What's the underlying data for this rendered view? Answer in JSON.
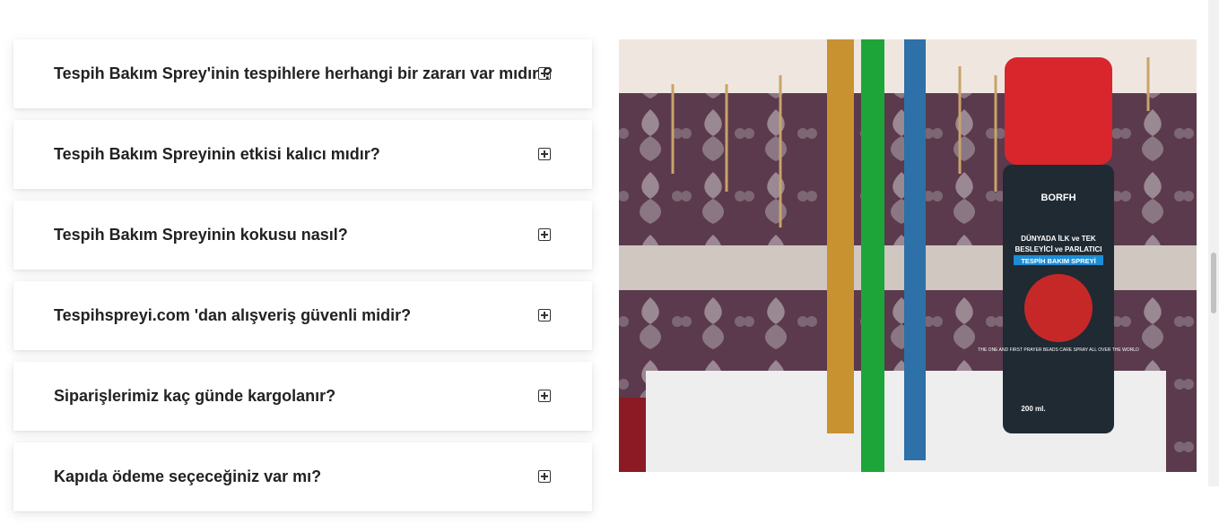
{
  "faq": {
    "items": [
      {
        "question": "Tespih Bakım Sprey'inin tespihlere herhangi bir zararı var mıdır ?",
        "toggle_icon": "plus-square-icon"
      },
      {
        "question": "Tespih Bakım Spreyinin etkisi kalıcı mıdır?",
        "toggle_icon": "plus-square-icon"
      },
      {
        "question": "Tespih Bakım Spreyinin kokusu nasıl?",
        "toggle_icon": "plus-square-icon"
      },
      {
        "question": "Tespihspreyi.com 'dan alışveriş güvenli midir?",
        "toggle_icon": "plus-square-icon"
      },
      {
        "question": "Siparişlerimiz kaç günde kargolanır?",
        "toggle_icon": "plus-square-icon"
      },
      {
        "question": "Kapıda ödeme seçeceğiniz var mı?",
        "toggle_icon": "plus-square-icon"
      }
    ]
  },
  "product_image": {
    "can_label": {
      "brand": "BORFH",
      "line1": "DÜNYADA İLK ve TEK",
      "line2": "BESLEYİCİ ve PARLATICI",
      "line3": "TESPİH BAKIM SPREYİ",
      "english": "THE ONE AND FIRST PRAYER BEADS CARE SPRAY ALL OVER THE WORLD",
      "volume": "200 ml."
    }
  },
  "colors": {
    "can_red": "#d9262c",
    "can_body": "#1f2a33",
    "accent_blue": "#1c8ed6"
  }
}
